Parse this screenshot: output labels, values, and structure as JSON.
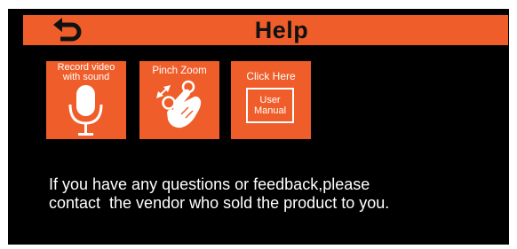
{
  "header": {
    "back_icon": "back-arrow-icon",
    "title": "Help"
  },
  "tiles": [
    {
      "label_line1": "Record video",
      "label_line2": "with sound",
      "icon": "microphone-icon"
    },
    {
      "label": "Pinch Zoom",
      "icon": "pinch-zoom-hand-icon"
    },
    {
      "label": "Click Here",
      "manual_line1": "User",
      "manual_line2": "Manual"
    }
  ],
  "message": {
    "line1": "If you have any questions or feedback,please",
    "line2": "contact  the vendor who sold the product to you."
  },
  "colors": {
    "accent": "#ef5e2a",
    "background": "#000000",
    "text": "#ffffff"
  }
}
